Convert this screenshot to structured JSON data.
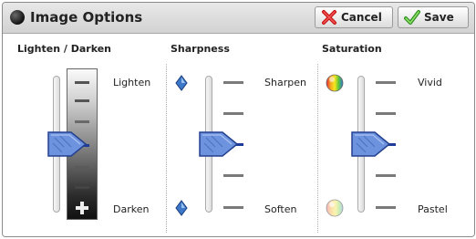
{
  "window": {
    "title": "Image Options"
  },
  "toolbar": {
    "cancel_label": "Cancel",
    "save_label": "Save"
  },
  "lighten_darken": {
    "title": "Lighten / Darken",
    "top_label": "Lighten",
    "bottom_label": "Darken",
    "level": 0.5
  },
  "sharpness": {
    "title": "Sharpness",
    "top_label": "Sharpen",
    "bottom_label": "Soften",
    "level": 0.5
  },
  "saturation": {
    "title": "Saturation",
    "top_label": "Vivid",
    "bottom_label": "Pastel",
    "level": 0.5
  },
  "icons": {
    "title": "black-ball-icon",
    "cancel": "red-x-icon",
    "save": "green-check-icon",
    "sharpen": "blue-diamond-icon",
    "vivid": "rainbow-ball-icon",
    "pastel": "pastel-ball-icon"
  },
  "colors": {
    "accent": "#1e3d9a",
    "thumb": "#6e93de"
  }
}
